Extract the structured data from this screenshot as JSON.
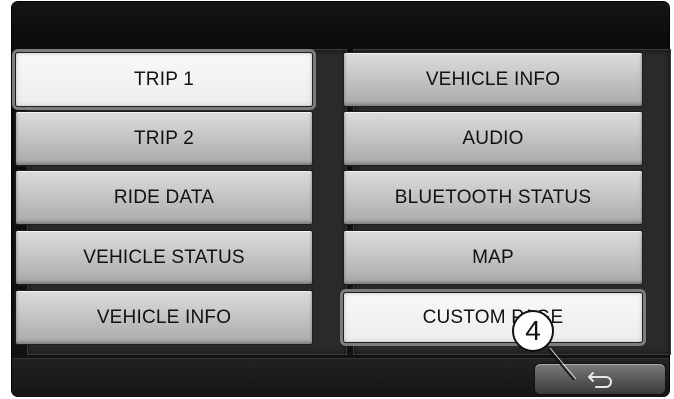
{
  "menu": {
    "left": [
      "TRIP 1",
      "TRIP 2",
      "RIDE DATA",
      "VEHICLE STATUS",
      "VEHICLE INFO"
    ],
    "right": [
      "VEHICLE INFO",
      "AUDIO",
      "BLUETOOTH STATUS",
      "MAP",
      "CUSTOM PAGE"
    ]
  },
  "selected": [
    "TRIP 1",
    "CUSTOM PAGE"
  ],
  "callout_number": "4",
  "icons": {
    "back": "return-arrow-icon"
  }
}
